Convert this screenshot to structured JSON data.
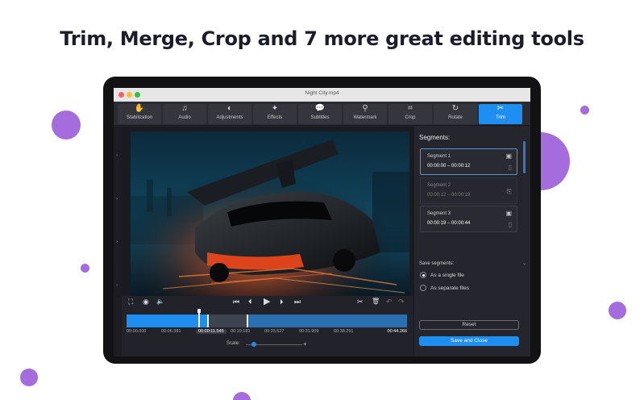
{
  "headline": "Trim, Merge, Crop and 7 more great editing tools",
  "window": {
    "title": "Night City.mp4"
  },
  "toolbar": {
    "items": [
      {
        "label": "Stabilization",
        "icon": "hand-icon",
        "glyph": "✋"
      },
      {
        "label": "Audio",
        "icon": "music-note-icon",
        "glyph": "♫"
      },
      {
        "label": "Adjustments",
        "icon": "contrast-icon",
        "glyph": "◐"
      },
      {
        "label": "Effects",
        "icon": "magic-wand-icon",
        "glyph": "✦"
      },
      {
        "label": "Subtitles",
        "icon": "speech-bubble-icon",
        "glyph": "💬"
      },
      {
        "label": "Watermark",
        "icon": "stamp-icon",
        "glyph": "⚲"
      },
      {
        "label": "Crop",
        "icon": "crop-icon",
        "glyph": "⌗"
      },
      {
        "label": "Rotate",
        "icon": "rotate-icon",
        "glyph": "↻"
      },
      {
        "label": "Trim",
        "icon": "scissors-icon",
        "glyph": "✂"
      }
    ],
    "active": "Trim"
  },
  "player": {
    "glyphs": {
      "fullscreen": "⛶",
      "snapshot": "◉",
      "volume": "🔈",
      "skip_start": "⏮",
      "step_back": "⏴",
      "play": "▶",
      "step_forward": "⏵",
      "skip_end": "⏭",
      "cut": "✂",
      "delete": "🗑",
      "undo": "↶",
      "redo": "↷"
    }
  },
  "timeline": {
    "labels": [
      "00:00.000",
      "00:06.381",
      "00:00:11.545",
      "00:19.181",
      "00:25.527",
      "00:31.909",
      "00:38.291",
      "00:44.266"
    ],
    "current": "00:00:11.545",
    "playhead_fraction": 0.26,
    "split_fractions": [
      0.29,
      0.43
    ],
    "scale_label": "Scale:",
    "scale_plus": "+",
    "scale_value": 0.1
  },
  "segments_panel": {
    "title": "Segments:",
    "segments": [
      {
        "name": "Segment 1",
        "range": "00:00:00 – 00:00:12",
        "state": "selected"
      },
      {
        "name": "Segment 2",
        "range": "00:00:12 – 00:00:19",
        "state": "disabled"
      },
      {
        "name": "Segment 3",
        "range": "00:00:19 – 00:00:44",
        "state": "normal"
      }
    ],
    "save_label": "Save segments:",
    "options": [
      "As a single file",
      "As separate files"
    ],
    "selected_option": "As a single file",
    "reset_label": "Reset",
    "save_close_label": "Save and Close"
  },
  "colors": {
    "accent": "#1e8ef0",
    "decor": "#a46cdc",
    "timeline": "#2a6fb0"
  }
}
